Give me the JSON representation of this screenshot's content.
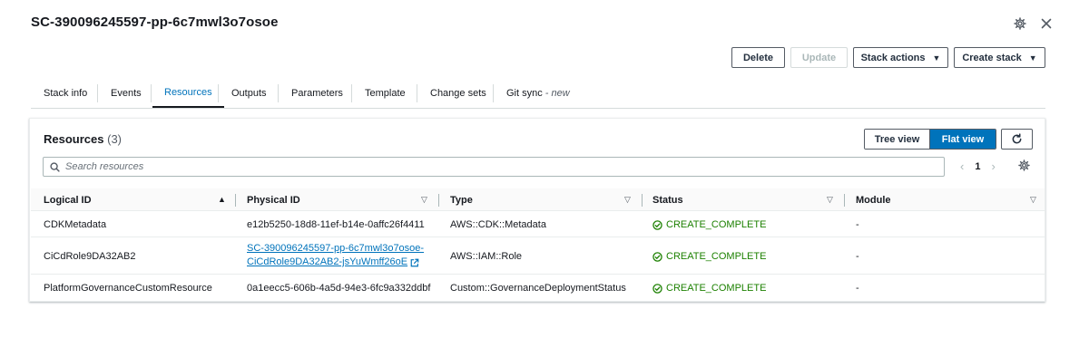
{
  "header": {
    "title": "SC-390096245597-pp-6c7mwl3o7osoe",
    "settings_icon": "gear-icon",
    "close_icon": "close-icon"
  },
  "toolbar": {
    "delete_label": "Delete",
    "update_label": "Update",
    "stack_actions_label": "Stack actions",
    "create_stack_label": "Create stack"
  },
  "tabs": [
    {
      "label": "Stack info"
    },
    {
      "label": "Events"
    },
    {
      "label": "Resources"
    },
    {
      "label": "Outputs"
    },
    {
      "label": "Parameters"
    },
    {
      "label": "Template"
    },
    {
      "label": "Change sets"
    },
    {
      "label": "Git sync",
      "suffix": "- new"
    }
  ],
  "resources": {
    "title": "Resources",
    "count": "(3)",
    "tree_view_label": "Tree view",
    "flat_view_label": "Flat view",
    "search_placeholder": "Search resources",
    "page": "1",
    "columns": [
      "Logical ID",
      "Physical ID",
      "Type",
      "Status",
      "Module"
    ],
    "rows": [
      {
        "logical_id": "CDKMetadata",
        "physical_id": "e12b5250-18d8-11ef-b14e-0affc26f4411",
        "type": "AWS::CDK::Metadata",
        "status": "CREATE_COMPLETE",
        "module": "-"
      },
      {
        "logical_id": "CiCdRole9DA32AB2",
        "physical_id_line1": "SC-390096245597-pp-6c7mwl3o7osoe-",
        "physical_id_line2": "CiCdRole9DA32AB2-jsYuWmff26oE",
        "type": "AWS::IAM::Role",
        "status": "CREATE_COMPLETE",
        "module": "-"
      },
      {
        "logical_id": "PlatformGovernanceCustomResource",
        "physical_id": "0a1eecc5-606b-4a5d-94e3-6fc9a332ddbf",
        "type": "Custom::GovernanceDeploymentStatus",
        "status": "CREATE_COMPLETE",
        "module": "-"
      }
    ]
  },
  "colors": {
    "accent": "#0073bb",
    "success": "#1d8102"
  }
}
